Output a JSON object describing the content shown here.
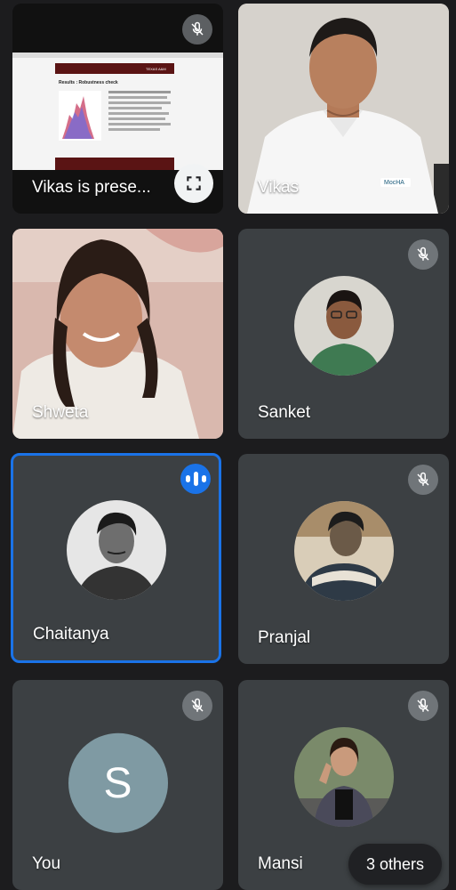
{
  "tiles": {
    "presenter": {
      "label": "Vikas is prese..."
    },
    "vikas": {
      "name": "Vikas",
      "shirt_text": "MocHA"
    },
    "shweta": {
      "name": "Shweta"
    },
    "sanket": {
      "name": "Sanket"
    },
    "chaitanya": {
      "name": "Chaitanya"
    },
    "pranjal": {
      "name": "Pranjal"
    },
    "you": {
      "name": "You",
      "initial": "S"
    },
    "mansi": {
      "name": "Mansi"
    }
  },
  "overflow": {
    "label": "3 others"
  },
  "slide": {
    "title": "Results : Robustness check",
    "logo": "TEXAS A&M"
  },
  "colors": {
    "tile_bg": "#3c4043",
    "speaking_border": "#1a73e8",
    "mic_badge": "#9aa0a6"
  },
  "icons": {
    "muted": "mic-off-icon",
    "speaking": "audio-level-icon",
    "fullscreen": "fullscreen-icon"
  }
}
